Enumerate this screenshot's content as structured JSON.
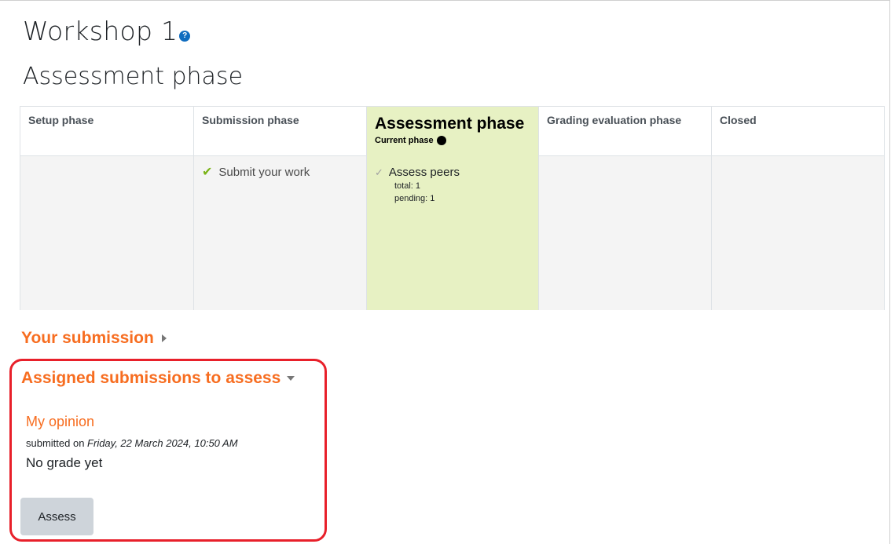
{
  "page": {
    "title": "Workshop 1",
    "help_icon": "question-circle-icon",
    "phase_heading": "Assessment phase"
  },
  "planner": {
    "phases": [
      {
        "name": "Setup phase",
        "active": false,
        "tasks": []
      },
      {
        "name": "Submission phase",
        "active": false,
        "tasks": [
          {
            "label": "Submit your work",
            "status": "done"
          }
        ]
      },
      {
        "name": "Assessment phase",
        "active": true,
        "current_label": "Current phase",
        "tasks": [
          {
            "label": "Assess peers",
            "status": "todo",
            "details": [
              "total: 1",
              "pending: 1"
            ]
          }
        ]
      },
      {
        "name": "Grading evaluation phase",
        "active": false,
        "tasks": []
      },
      {
        "name": "Closed",
        "active": false,
        "tasks": []
      }
    ]
  },
  "sections": {
    "your_submission": "Your submission",
    "assigned": "Assigned submissions to assess"
  },
  "submission": {
    "title": "My opinion",
    "submitted_prefix": "submitted on ",
    "submitted_date": "Friday, 22 March 2024, 10:50 AM",
    "grade": "No grade yet",
    "assess_button": "Assess"
  },
  "colors": {
    "accent": "#f76d20",
    "active_phase_bg": "#e7f1c3",
    "highlight_border": "#e8202a",
    "done_check": "#7ab317"
  }
}
